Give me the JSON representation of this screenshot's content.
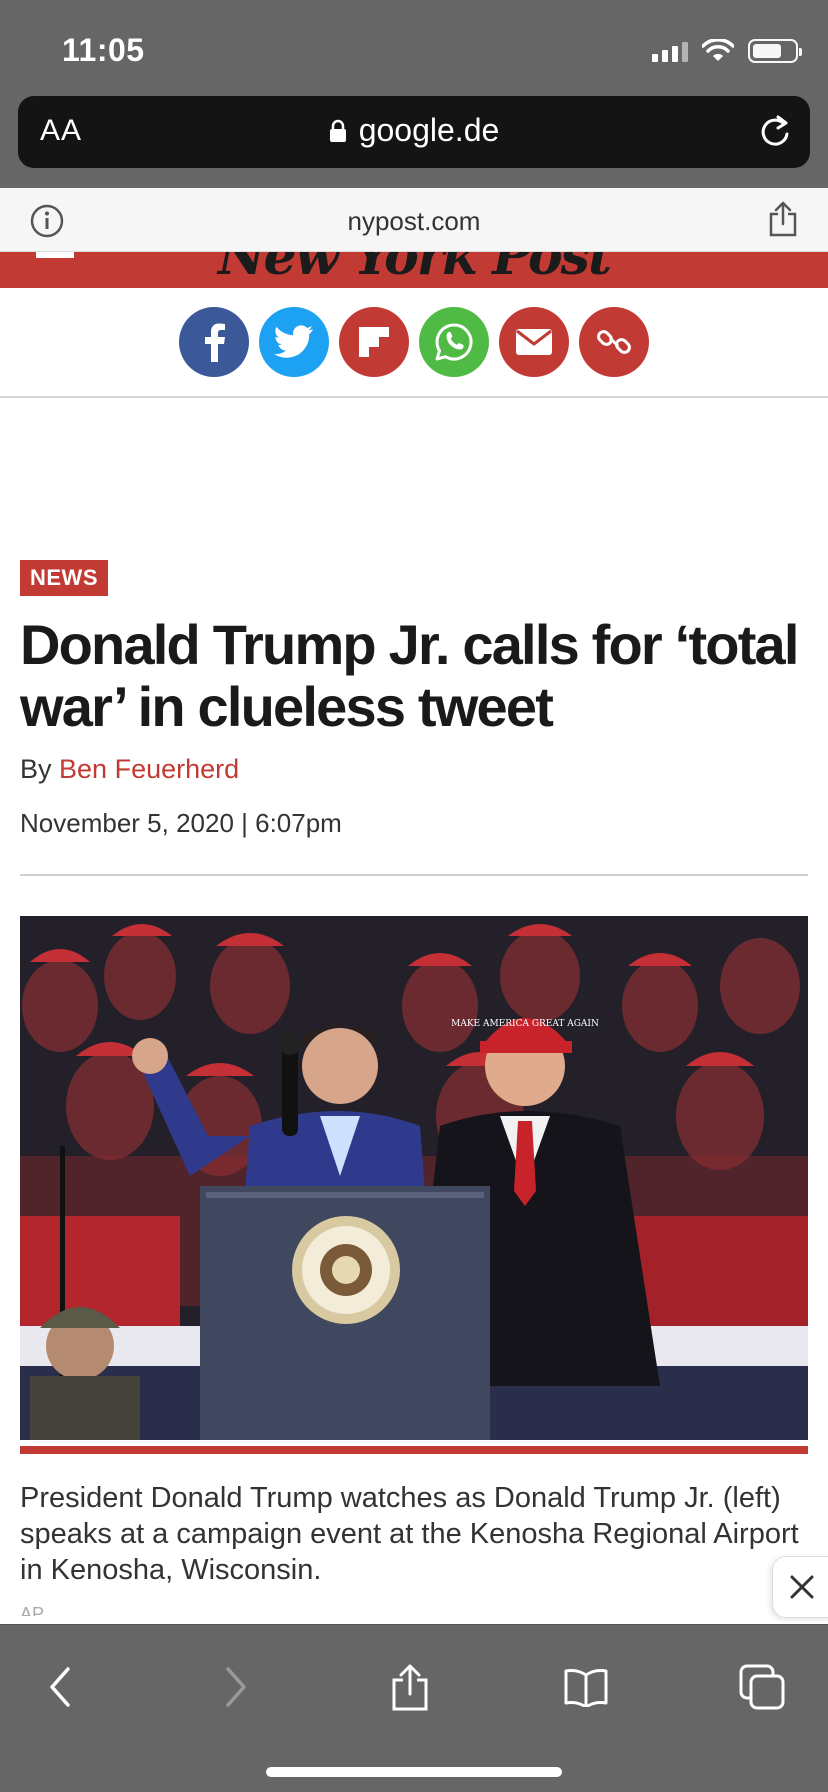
{
  "status_bar": {
    "time": "11:05"
  },
  "browser": {
    "text_size_label": "AA",
    "address": "google.de"
  },
  "site_bar": {
    "domain": "nypost.com"
  },
  "masthead": {
    "logo_text": "New York Post"
  },
  "share_buttons": [
    {
      "network": "facebook",
      "color": "#3b5998",
      "icon": "facebook-icon"
    },
    {
      "network": "twitter",
      "color": "#1da1f2",
      "icon": "twitter-icon"
    },
    {
      "network": "flipboard",
      "color": "#c23a34",
      "icon": "flipboard-icon"
    },
    {
      "network": "whatsapp",
      "color": "#4fbb45",
      "icon": "whatsapp-icon"
    },
    {
      "network": "email",
      "color": "#c23a34",
      "icon": "mail-icon"
    },
    {
      "network": "copy-link",
      "color": "#c23a34",
      "icon": "link-icon"
    }
  ],
  "article": {
    "category": "NEWS",
    "headline": "Donald Trump Jr. calls for ‘total war’ in clueless tweet",
    "byline_prefix": "By",
    "author": "Ben Feuerherd",
    "date": "November 5, 2020 | 6:07pm",
    "photo_caption": "President Donald Trump watches as Donald Trump Jr. (left) speaks at a campaign event at the Kenosha Regional Airport in Kenosha, Wisconsin.",
    "photo_credit": "AP",
    "hat_text": "MAKE AMERICA GREAT AGAIN"
  },
  "colors": {
    "brand_red": "#c23a34",
    "chrome_gray": "#666666"
  }
}
